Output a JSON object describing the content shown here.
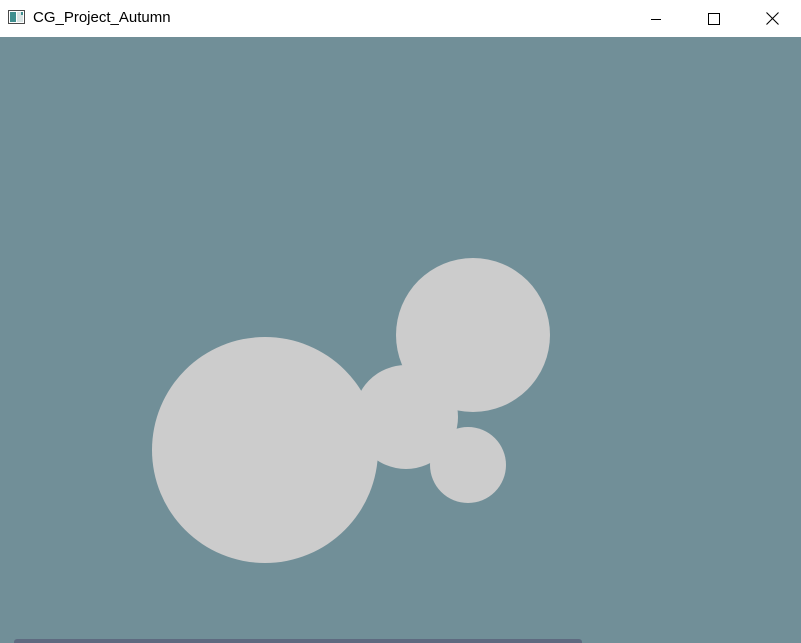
{
  "window": {
    "title": "CG_Project_Autumn",
    "app_icon": "opengl-window-icon",
    "controls": {
      "minimize_icon": "minimize-icon",
      "maximize_icon": "maximize-icon",
      "close_icon": "close-icon"
    }
  },
  "scene": {
    "background_color": "#718f98",
    "circle_color": "#cccccc",
    "circle_count": 4
  },
  "colors": {
    "titlebar": "#ffffff",
    "title_text": "#000000"
  }
}
